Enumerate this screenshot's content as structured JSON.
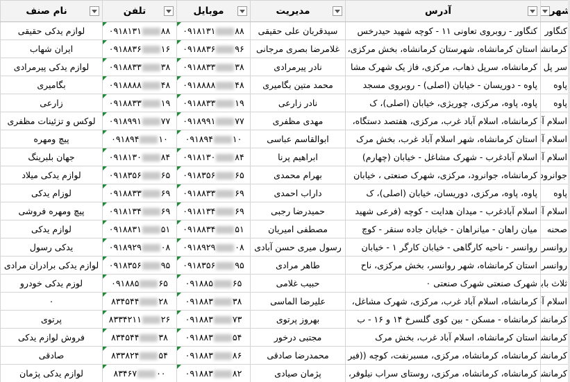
{
  "headers": {
    "name": "نام صنف",
    "phone": "تلفن",
    "mobile": "موبایل",
    "manager": "مدیریت",
    "address": "آدرس",
    "city": "شهر"
  },
  "rows": [
    {
      "name": "لوازم یدکی حقیقی",
      "phone": [
        "۰۹۱۸۱۳۱",
        "۸۸"
      ],
      "mobile": [
        "۰۹۱۸۱۳۱",
        "۸۸"
      ],
      "manager": "سیدقربان علی حقیقی",
      "address": "کنگاور - روبروی تعاونی ۱۱ - کوچه شهید حیدرخس",
      "city": "کنگاور"
    },
    {
      "name": "ایران شهاب",
      "phone": [
        "۰۹۱۸۸۳۶",
        "۱۶"
      ],
      "mobile": [
        "۰۹۱۸۸۳۶",
        "۹۶"
      ],
      "manager": "غلامرضا بصری مرجانی",
      "address": "استان کرمانشاه، شهرستان کرمانشاه، بخش مرکزی،",
      "city": "کرمانشاه"
    },
    {
      "name": "لوازم یدکی پیرمرادی",
      "phone": [
        "۰۹۱۸۸۳۳",
        "۳۸"
      ],
      "mobile": [
        "۰۹۱۸۸۳۳",
        "۳۸"
      ],
      "manager": "نادر پیرمرادی",
      "address": "کرمانشاه، سرپل ذهاب، مرکزی، فاز یک شهرک مشا",
      "city": "سر پل ذ"
    },
    {
      "name": "بگامیری",
      "phone": [
        "۰۹۱۸۸۸۸",
        "۴۸"
      ],
      "mobile": [
        "۰۹۱۸۸۸۸",
        "۴۸"
      ],
      "manager": "محمد متین بگامیری",
      "address": "پاوه - دوریسان - خیابان (اصلی) - روبروی مسجد",
      "city": "پاوه"
    },
    {
      "name": "زارعی",
      "phone": [
        "۰۹۱۸۸۳۳",
        "۱۹"
      ],
      "mobile": [
        "۰۹۱۸۸۳۳",
        "۱۹"
      ],
      "manager": "نادر زارعی",
      "address": "پاوه، پاوه، مرکزی، چوریژی، خیابان (اصلی)، ک",
      "city": "پاوه"
    },
    {
      "name": "لوکس و تزئینات مظفری",
      "phone": [
        "۰۹۱۸۹۹۱",
        "۷۷"
      ],
      "mobile": [
        "۰۹۱۸۹۹۱",
        "۷۷"
      ],
      "manager": "مهدی مظفری",
      "address": "کرمانشاه، اسلام آباد غرب، مرکزی، هفتصد دستگاه،",
      "city": "اسلام آبا"
    },
    {
      "name": "پیچ ومهره",
      "phone": [
        "۰۹۱۸۹۴",
        "۱۰"
      ],
      "mobile": [
        "۰۹۱۸۹۴",
        "۱۰"
      ],
      "manager": "ابوالقاسم عباسی",
      "address": "استان کرمانشاه، شهر اسلام آباد غرب، بخش مرک",
      "city": "اسلام آبا"
    },
    {
      "name": "جهان بلبرینگ",
      "phone": [
        "۰۹۱۸۱۳۰",
        "۸۴"
      ],
      "mobile": [
        "۰۹۱۸۱۳۰",
        "۸۴"
      ],
      "manager": "ابراهیم پرنا",
      "address": "اسلام آبادغرب - شهرک مشاغل - خیابان (چهارم)",
      "city": "اسلام آبا"
    },
    {
      "name": "لوازم یدکی میلاد",
      "phone": [
        "۰۹۱۸۳۵۶",
        "۶۵"
      ],
      "mobile": [
        "۰۹۱۸۳۵۶",
        "۶۵"
      ],
      "manager": "بهرام محمدی",
      "address": "کرمانشاه، جوانرود، مرکزی، شهرک صنعتی ، خیابان",
      "city": "جوانرود"
    },
    {
      "name": "لوزام یدکی",
      "phone": [
        "۰۹۱۸۸۳۳",
        "۶۹"
      ],
      "mobile": [
        "۰۹۱۸۸۳۳",
        "۶۹"
      ],
      "manager": "داراب احمدی",
      "address": "پاوه، پاوه، مرکزی، دوریسان، خیابان (اصلی)، ک",
      "city": "پاوه"
    },
    {
      "name": "پیچ ومهره فروشی",
      "phone": [
        "۰۹۱۸۱۳۴",
        "۶۹"
      ],
      "mobile": [
        "۰۹۱۸۱۳۴",
        "۶۹"
      ],
      "manager": "حمیدرضا رجبی",
      "address": "اسلام آبادغرب - میدان هدایت - کوچه (فرعی شهید",
      "city": "اسلام آبا"
    },
    {
      "name": "لوازم یدکی",
      "phone": [
        "۰۹۱۸۸۳۱",
        "۵۱"
      ],
      "mobile": [
        "۰۹۱۸۸۳۴",
        "۵۱"
      ],
      "manager": "مصطفی امیریان",
      "address": "میان راهان - میانراهان - خیابان جاده سنقر - کوچ",
      "city": "صحنه"
    },
    {
      "name": "یدکی رسول",
      "phone": [
        "۰۹۱۸۹۲۹",
        "۰۸"
      ],
      "mobile": [
        "۰۹۱۸۹۲۹",
        "۰۸"
      ],
      "manager": "رسول میری حسن آبادی",
      "address": "روانسر - ناحیه کارگاهی - خیابان کارگر ۱ - خیابان",
      "city": "روانسر"
    },
    {
      "name": "لوازم یدکی برادران مرادی",
      "phone": [
        "۰۹۱۸۳۵۶",
        "۹۵"
      ],
      "mobile": [
        "۰۹۱۸۳۵۶",
        "۹۵"
      ],
      "manager": "طاهر مرادی",
      "address": "استان کرمانشاه، شهر روانسر، بخش مرکزی، ناح",
      "city": "روانسر"
    },
    {
      "name": "لوزم یدکی خودرو",
      "phone": [
        "۰۹۱۸۸۵",
        "۶۵"
      ],
      "mobile": [
        "۰۹۱۸۸۵",
        "۶۵"
      ],
      "manager": "حبیب غلامی",
      "address": "شهرک صنعتی شهرک صنعتی ۰",
      "city": "ثلاث بابا"
    },
    {
      "name": "۰",
      "phone": [
        "۸۳۴۵۴۴",
        "۲۸"
      ],
      "mobile": [
        "۰۹۱۸۸۳",
        "۳۸"
      ],
      "manager": "علیرضا الماسی",
      "address": "کرمانشاه، اسلام آباد غرب، مرکزی، شهرک مشاغل،",
      "city": "اسلام آبا"
    },
    {
      "name": "پرتوی",
      "phone": [
        "۸۳۳۴۲۱۱",
        "۲۶"
      ],
      "mobile": [
        "۰۹۱۸۸۳",
        "۷۳"
      ],
      "manager": "بهروز پرتوی",
      "address": "کرمانشاه - مسکن - بین کوی گلسرخ ۱۴ و ۱۶ - ب",
      "city": "کرمانشاه"
    },
    {
      "name": "فروش لوازم یدکی",
      "phone": [
        "۸۳۴۵۴۴",
        "۳۸"
      ],
      "mobile": [
        "۰۹۱۸۸۳",
        "۵۴"
      ],
      "manager": "مجتبی درخور",
      "address": "استان کرمانشاه، اسلام آباد غرب، بخش مرک",
      "city": "کرمانشاه"
    },
    {
      "name": "صادقی",
      "phone": [
        "۸۳۳۸۲۴",
        "۵۴"
      ],
      "mobile": [
        "۰۹۱۸۸۳",
        "۸۶"
      ],
      "manager": "محمدرضا صادقی",
      "address": "کرمانشاه، کرمانشاه، مرکزی، مسبرنفت، کوچه ((فیر",
      "city": "کرمانشاه"
    },
    {
      "name": "لوازم یدکی پژمان",
      "phone": [
        "۸۳۴۶۷",
        "۰۰"
      ],
      "mobile": [
        "۰۹۱۸۸۳",
        "۸۲"
      ],
      "manager": "پژمان صیادی",
      "address": "کرمانشاه، کرمانشاه، مرکزی، روستای سراب نیلوفر،",
      "city": "کرمانشاه"
    }
  ]
}
